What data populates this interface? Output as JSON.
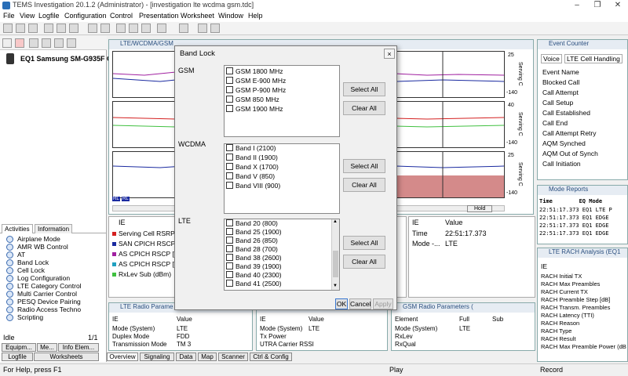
{
  "window": {
    "title": "TEMS Investigation 20.1.2 (Administrator) - [investigation lte wcdma gsm.tdc]"
  },
  "menu": [
    "File",
    "View",
    "Logfile",
    "Configuration",
    "Control",
    "Presentation",
    "Worksheet",
    "Window",
    "Help"
  ],
  "left_panel": {
    "equipment": "EQ1  Samsung SM-G935F O",
    "tabs": [
      "Activities",
      "Information"
    ],
    "activities": [
      "Airplane Mode",
      "AMR WB Control",
      "AT",
      "Band Lock",
      "Cell Lock",
      "Log Configuration",
      "LTE Category Control",
      "Multi Carrier Control",
      "PESQ Device Pairing",
      "Radio Access Techno",
      "Scripting"
    ],
    "status_left": "Idle",
    "status_right": "1/1",
    "bottom_tabs_row1": [
      "Equipm...",
      "Me...",
      "Info Elem..."
    ],
    "bottom_tabs_row2": [
      "Logfile",
      "Worksheets"
    ]
  },
  "lte_window": {
    "title": "LTE/WCDMA/GSM",
    "serving_labels": [
      "Serving C",
      "Serving C",
      "Serving C"
    ],
    "scale_top": [
      "25",
      "40",
      "25"
    ],
    "scale_bottom": [
      "-140",
      "-140",
      "-140"
    ],
    "hold_label": "Hold",
    "rl_label": "RL"
  },
  "ie_panel": {
    "header": "IE",
    "rows": [
      {
        "label": "Serving Cell RSRP (d",
        "color": "#d42020"
      },
      {
        "label": "SAN CPICH RSCP [1",
        "color": "#1a2aa0"
      },
      {
        "label": "AS CPICH RSCP [2]",
        "color": "#a020a0"
      },
      {
        "label": "AS CPICH RSCP [3]",
        "color": "#20a0c0"
      },
      {
        "label": "RxLev Sub (dBm)",
        "color": "#40c040"
      }
    ]
  },
  "val_panel": {
    "col1": "IE",
    "col2": "Value",
    "rows": [
      [
        "Time",
        "22:51:17.373"
      ],
      [
        "Mode -...",
        "LTE"
      ]
    ]
  },
  "lte_radio": {
    "title": "LTE Radio Parame",
    "headers": [
      "IE",
      "Value"
    ],
    "rows": [
      [
        "Mode (System)",
        "LTE"
      ],
      [
        "Duplex Mode",
        "FDD"
      ],
      [
        "Transmission Mode",
        "TM 3"
      ]
    ]
  },
  "wcdma_radio": {
    "headers": [
      "IE",
      "Value"
    ],
    "rows": [
      [
        "Mode (System)",
        "LTE"
      ],
      [
        "Tx Power",
        ""
      ],
      [
        "UTRA Carrier RSSI",
        ""
      ]
    ]
  },
  "gsm_radio": {
    "title": "GSM Radio Parameters (",
    "headers": [
      "Element",
      "Full",
      "Sub"
    ],
    "rows": [
      [
        "Mode (System)",
        "LTE",
        ""
      ],
      [
        "RxLev",
        "",
        ""
      ],
      [
        "RxQual",
        "",
        ""
      ]
    ]
  },
  "event_counter": {
    "title": "Event Counter",
    "tabs": [
      "Voice",
      "LTE Cell Handling"
    ],
    "items": [
      "Event Name",
      "Blocked Call",
      "Call Attempt",
      "Call Setup",
      "Call Established",
      "Call End",
      "Call Attempt Retry",
      "AQM Synched",
      "AQM Out of Synch",
      "Call Initiation"
    ]
  },
  "mode_reports": {
    "title": "Mode Reports",
    "header": [
      "Time",
      "EQ",
      "Mode"
    ],
    "rows": [
      [
        "22:51:17.373",
        "EQ1",
        "LTE P"
      ],
      [
        "22:51:17.373",
        "EQ1",
        "EDGE"
      ],
      [
        "22:51:17.373",
        "EQ1",
        "EDGE"
      ],
      [
        "22:51:17.373",
        "EQ1",
        "EDGE"
      ]
    ]
  },
  "rach": {
    "title": "LTE RACH Analysis (EQ1",
    "items": [
      "IE",
      "RACH Initial TX",
      "RACH Max Preambles",
      "RACH Current TX",
      "RACH Preamble Step [dB]",
      "RACH Transm. Preambles",
      "RACH Latency (TTI)",
      "RACH Reason",
      "RACH Type",
      "RACH Result",
      "RACH Max Preamble Power (dB"
    ]
  },
  "main_tabs": [
    "Overview",
    "Signaling",
    "Data",
    "Map",
    "Scanner",
    "Ctrl & Config"
  ],
  "statusbar": {
    "help": "For Help, press F1",
    "play": "Play",
    "record": "Record"
  },
  "dialog": {
    "title": "Band Lock",
    "close": "×",
    "gsm": {
      "label": "GSM",
      "bands": [
        "GSM 1800 MHz",
        "GSM E-900 MHz",
        "GSM P-900 MHz",
        "GSM 850 MHz",
        "GSM 1900 MHz"
      ]
    },
    "wcdma": {
      "label": "WCDMA",
      "bands": [
        "Band I (2100)",
        "Band II (1900)",
        "Band X (1700)",
        "Band V (850)",
        "Band VIII (900)"
      ]
    },
    "lte": {
      "label": "LTE",
      "bands": [
        "Band 20 (800)",
        "Band 25 (1900)",
        "Band 26 (850)",
        "Band 28 (700)",
        "Band 38 (2600)",
        "Band 39 (1900)",
        "Band 40 (2300)",
        "Band 41 (2500)"
      ]
    },
    "select_all": "Select All",
    "clear_all": "Clear All",
    "ok": "OK",
    "cancel": "Cancel",
    "apply": "Apply"
  },
  "colors": {
    "accent": "#2a4f7f",
    "graph_fill": "#d48a8a"
  }
}
